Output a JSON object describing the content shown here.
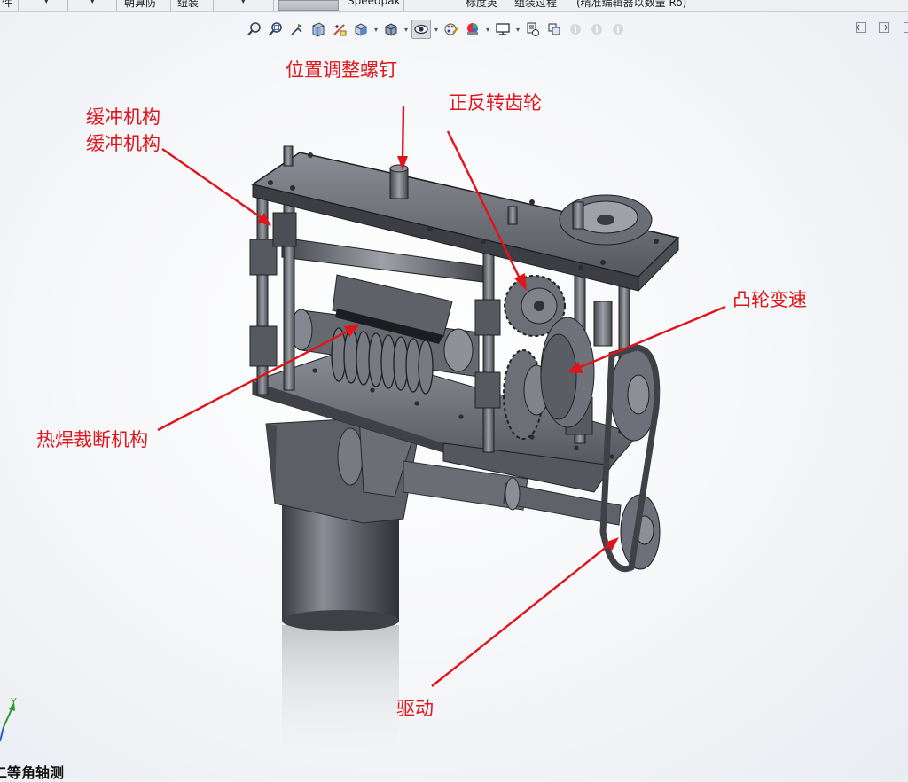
{
  "menubar": {
    "cells": [
      "件",
      "朝算防",
      "纽装",
      "Speedpak",
      "标度英",
      "组装过程",
      "(精准编辑器以数量 Ro)"
    ]
  },
  "annotations": {
    "position_screw": "位置调整螺钉",
    "gear": "正反转齿轮",
    "buffer_1": "缓冲机构",
    "buffer_2": "缓冲机构",
    "cam": "凸轮变速",
    "welding": "热焊裁断机构",
    "drive": "驱动"
  },
  "triad": {
    "axis_label": "Y"
  },
  "view_name": "二等角轴测",
  "colors": {
    "annotation": "#e0141a",
    "part": "#6d7078"
  },
  "toolbar_icons": [
    "zoom-to-fit-icon",
    "zoom-area-icon",
    "previous-view-icon",
    "section-view-icon",
    "dynamic-annotation-icon",
    "view-orientation-icon",
    "display-style-icon",
    "hide-show-items-icon",
    "edit-appearance-icon",
    "apply-scene-icon",
    "view-setting-icon",
    "render-tools-icon"
  ]
}
